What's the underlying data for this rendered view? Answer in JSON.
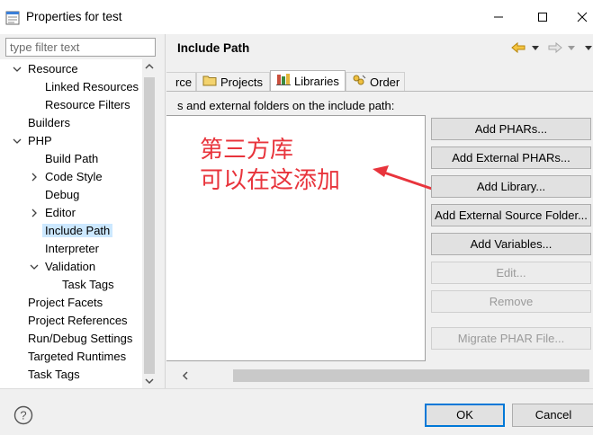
{
  "window": {
    "title": "Properties for test",
    "icon": "properties-icon"
  },
  "filter": {
    "placeholder": "type filter text"
  },
  "tree": [
    {
      "label": "Resource",
      "level": 0,
      "twisty": "expanded"
    },
    {
      "label": "Linked Resources",
      "level": 1,
      "twisty": "none"
    },
    {
      "label": "Resource Filters",
      "level": 1,
      "twisty": "none"
    },
    {
      "label": "Builders",
      "level": 0,
      "twisty": "none"
    },
    {
      "label": "PHP",
      "level": 0,
      "twisty": "expanded"
    },
    {
      "label": "Build Path",
      "level": 1,
      "twisty": "none"
    },
    {
      "label": "Code Style",
      "level": 1,
      "twisty": "collapsed"
    },
    {
      "label": "Debug",
      "level": 1,
      "twisty": "none"
    },
    {
      "label": "Editor",
      "level": 1,
      "twisty": "collapsed"
    },
    {
      "label": "Include Path",
      "level": 1,
      "twisty": "none",
      "selected": true
    },
    {
      "label": "Interpreter",
      "level": 1,
      "twisty": "none"
    },
    {
      "label": "Validation",
      "level": 1,
      "twisty": "expanded"
    },
    {
      "label": "Task Tags",
      "level": 2,
      "twisty": "none"
    },
    {
      "label": "Project Facets",
      "level": 0,
      "twisty": "none"
    },
    {
      "label": "Project References",
      "level": 0,
      "twisty": "none"
    },
    {
      "label": "Run/Debug Settings",
      "level": 0,
      "twisty": "none"
    },
    {
      "label": "Targeted Runtimes",
      "level": 0,
      "twisty": "none"
    },
    {
      "label": "Task Tags",
      "level": 0,
      "twisty": "none"
    }
  ],
  "page": {
    "title": "Include Path",
    "tabs": [
      {
        "label": "rce",
        "icon": "",
        "active": false
      },
      {
        "label": "Projects",
        "icon": "folder-icon",
        "active": false
      },
      {
        "label": "Libraries",
        "icon": "library-icon",
        "active": true
      },
      {
        "label": "Order",
        "icon": "order-icon",
        "active": false
      }
    ],
    "description": "s and external folders on the include path:",
    "annotation_line1": "第三方库",
    "annotation_line2": "可以在这添加",
    "annotation_color": "#e8343c",
    "buttons": [
      {
        "label": "Add PHARs...",
        "enabled": true
      },
      {
        "label": "Add External PHARs...",
        "enabled": true
      },
      {
        "label": "Add Library...",
        "enabled": true
      },
      {
        "label": "Add External Source Folder...",
        "enabled": true
      },
      {
        "label": "Add Variables...",
        "enabled": true
      },
      {
        "label": "Edit...",
        "enabled": false
      },
      {
        "label": "Remove",
        "enabled": false
      },
      {
        "label": "Migrate PHAR File...",
        "enabled": false
      }
    ]
  },
  "dialog": {
    "ok_label": "OK",
    "cancel_label": "Cancel",
    "focus_color": "#0078d7"
  }
}
